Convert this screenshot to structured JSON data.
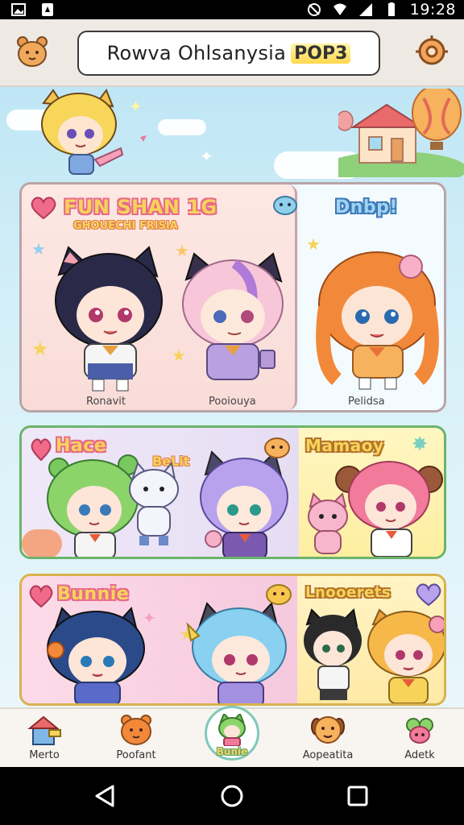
{
  "status_bar": {
    "time": "19:28",
    "icons": [
      "image-icon",
      "notification-icon",
      "mute-icon",
      "wifi-icon",
      "signal-icon",
      "battery-icon"
    ]
  },
  "header": {
    "title_main": "Rowva Ohlsanysia",
    "title_badge": "POP3",
    "left_icon": "bear-icon",
    "right_icon": "settings-icon"
  },
  "cards": [
    {
      "title": "FUN SHAN 1G",
      "subtitle": "GHOUECHI FRISIA",
      "side_title": "Dnbp!",
      "captions": [
        "Ronavit",
        "Pooiouya",
        "Pelidsa"
      ]
    },
    {
      "title": "Hace",
      "tag": "BeLit",
      "side_title": "Mamaoy"
    },
    {
      "title": "Bunnie",
      "side_title": "Lnooerets"
    }
  ],
  "bottom_nav": [
    {
      "label": "Merto",
      "icon": "home-icon"
    },
    {
      "label": "Poofant",
      "icon": "bear-face-icon"
    },
    {
      "label": "Bunie",
      "icon": "character-avatar-icon",
      "active": true
    },
    {
      "label": "Aopeatita",
      "icon": "dog-face-icon"
    },
    {
      "label": "Adetk",
      "icon": "flower-icon"
    }
  ],
  "colors": {
    "header_bg": "#eee9e3",
    "sky": "#bfe6f5",
    "title_fill": "#f6d35a",
    "title_outline": "#e86a8a"
  }
}
